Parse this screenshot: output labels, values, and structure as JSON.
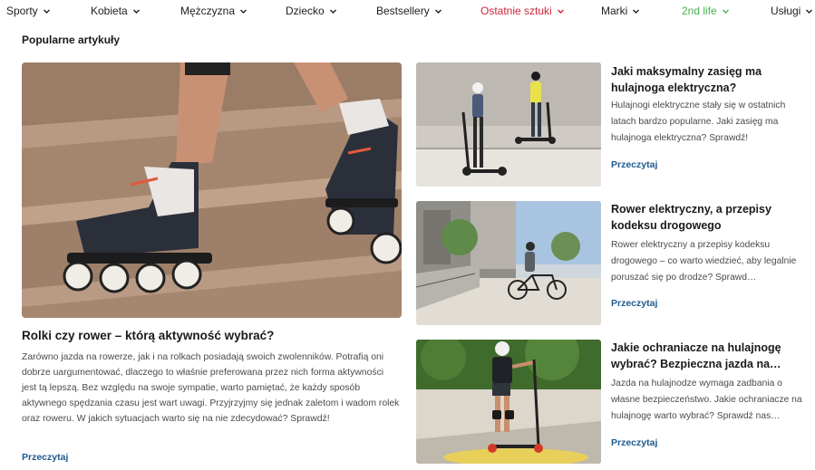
{
  "nav": {
    "items": [
      {
        "label": "Sporty",
        "color": "#1f1f1f"
      },
      {
        "label": "Kobieta",
        "color": "#1f1f1f"
      },
      {
        "label": "Mężczyzna",
        "color": "#1f1f1f"
      },
      {
        "label": "Dziecko",
        "color": "#1f1f1f"
      },
      {
        "label": "Bestsellery",
        "color": "#1f1f1f"
      },
      {
        "label": "Ostatnie sztuki",
        "color": "#d0243a"
      },
      {
        "label": "Marki",
        "color": "#1f1f1f"
      },
      {
        "label": "2nd life",
        "color": "#4caf50"
      },
      {
        "label": "Usługi",
        "color": "#1f1f1f"
      }
    ]
  },
  "section": {
    "title": "Popularne artykuły"
  },
  "featured": {
    "title": "Rolki czy rower – którą aktywność wybrać?",
    "text": "Zarówno jazda na rowerze, jak i na rolkach posiadają swoich zwolenników. Potrafią oni dobrze uargumentować, dlaczego to właśnie preferowana przez nich forma aktywności jest tą lepszą. Bez względu na swoje sympatie, warto pamiętać, że każdy sposób aktywnego spędzania czasu jest wart uwagi. Przyjrzyjmy się jednak zaletom i wadom rolek oraz roweru. W jakich sytuacjach warto się na nie zdecydować? Sprawdź!",
    "link": "Przeczytaj",
    "image_icon": "inline-skates-photo"
  },
  "cards": [
    {
      "title": "Jaki maksymalny zasięg ma hulajnoga elektryczna?",
      "text": "Hulajnogi elektryczne stały się w ostatnich latach bardzo popularne. Jaki zasięg ma hulajnoga elektryczna? Sprawdź!",
      "link": "Przeczytaj",
      "image_icon": "electric-scooters-photo"
    },
    {
      "title": "Rower elektryczny, a przepisy kodeksu drogowego",
      "text": "Rower elektryczny a przepisy kodeksu drogowego – co warto wiedzieć, aby legalnie poruszać się po drodze? Sprawd…",
      "link": "Przeczytaj",
      "image_icon": "electric-bike-photo"
    },
    {
      "title": "Jakie ochraniacze na hulajnogę wybrać? Bezpieczna jazda na…",
      "text": "Jazda na hulajnodze wymaga zadbania o własne bezpieczeństwo. Jakie ochraniacze na hulajnogę warto wybrać? Sprawdź nas…",
      "link": "Przeczytaj",
      "image_icon": "kid-scooter-photo"
    }
  ],
  "colors": {
    "link": "#1d5a8e",
    "accent_red": "#d0243a",
    "accent_green": "#4caf50"
  }
}
